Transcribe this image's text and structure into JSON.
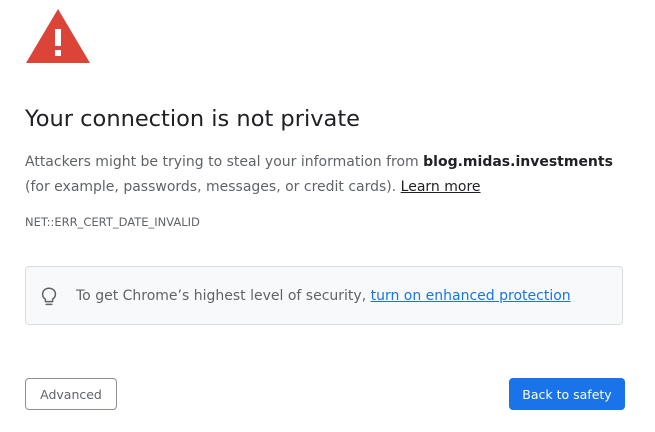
{
  "icons": {
    "warning": "warning-triangle-icon",
    "bulb": "lightbulb-icon"
  },
  "colors": {
    "warning_red": "#db4437",
    "link_blue": "#1a73e8",
    "primary_button": "#1a73e8",
    "text_primary": "#202124",
    "text_secondary": "#5f6368",
    "promo_background": "#f8f9fa"
  },
  "interstitial": {
    "heading": "Your connection is not private",
    "message_before": "Attackers might be trying to steal your information from ",
    "domain": "blog.midas.investments",
    "message_after": " (for example, passwords, messages, or credit cards). ",
    "learn_more": "Learn more",
    "error_code": "NET::ERR_CERT_DATE_INVALID"
  },
  "promo": {
    "text": "To get Chrome’s highest level of security, ",
    "link": "turn on enhanced protection"
  },
  "buttons": {
    "advanced": "Advanced",
    "back_to_safety": "Back to safety"
  }
}
